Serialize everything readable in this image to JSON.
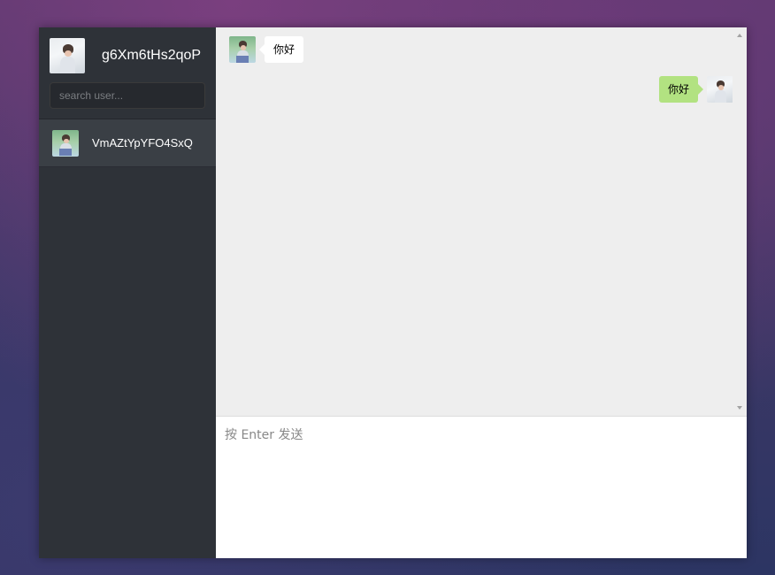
{
  "sidebar": {
    "current_user": {
      "name": "g6Xm6tHs2qoP",
      "avatar_icon": "user-avatar-icon"
    },
    "search": {
      "placeholder": "search user..."
    },
    "sessions": [
      {
        "name": "VmAZtYpYFO4SxQ",
        "avatar_icon": "contact-avatar-icon"
      }
    ]
  },
  "chat": {
    "messages": [
      {
        "from": "contact",
        "text": "你好"
      },
      {
        "from": "self",
        "text": "你好"
      }
    ],
    "input": {
      "placeholder": "按 Enter 发送",
      "value": ""
    }
  },
  "colors": {
    "sidebar_bg": "#2e3238",
    "active_item_bg": "#3a3f45",
    "chat_bg": "#eeeeee",
    "self_bubble": "#b2e281",
    "other_bubble": "#ffffff"
  }
}
